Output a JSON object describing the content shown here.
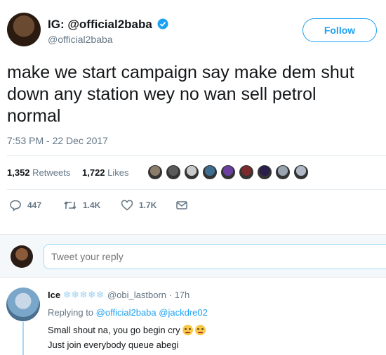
{
  "tweet": {
    "display_name": "IG: @official2baba",
    "handle": "@official2baba",
    "follow_label": "Follow",
    "text_lines": [
      "make we start campaign say make dem shut",
      "down any station wey no wan sell petrol",
      "normal"
    ],
    "timestamp": "7:53 PM - 22 Dec 2017",
    "retweets_count": "1,352",
    "retweets_label": "Retweets",
    "likes_count": "1,722",
    "likes_label": "Likes",
    "replies_count": "447",
    "retweet_action_count": "1.4K",
    "like_action_count": "1.7K"
  },
  "liker_avatars": [
    "#8b7d6b",
    "#5a5a5a",
    "#c9c9c9",
    "#3d6e91",
    "#6a3fa0",
    "#7a2a2a",
    "#2a1e4a",
    "#9aa4b0",
    "#b0b8c8"
  ],
  "reply_box": {
    "placeholder": "Tweet your reply"
  },
  "reply": {
    "name": "Ice",
    "snowflakes": "❄❄❄❄❄",
    "handle": "@obi_lastborn",
    "time": "· 17h",
    "replying_to_label": "Replying to",
    "mention1": "@official2baba",
    "mention2": "@jackdre02",
    "line1": "Small shout na, you go begin cry",
    "line2": "Just join everybody queue abegi"
  },
  "colors": {
    "accent": "#1da1f2",
    "muted": "#657786",
    "verified": "#1da1f2"
  }
}
